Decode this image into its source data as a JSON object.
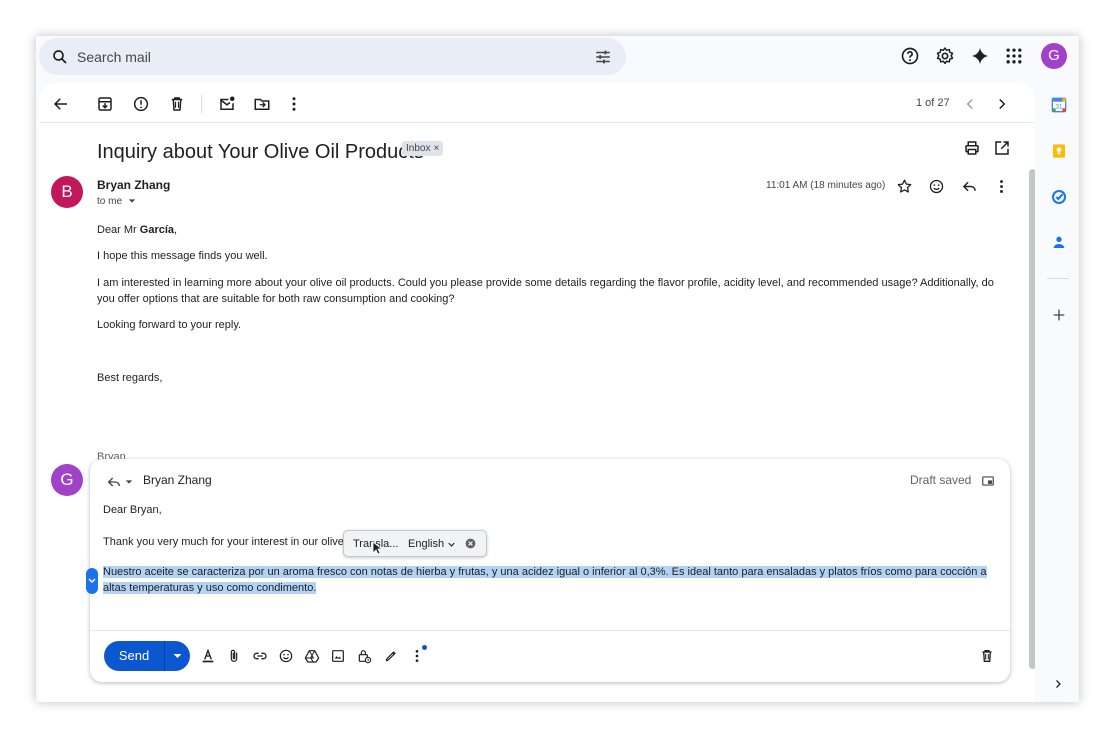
{
  "search": {
    "placeholder": "Search mail"
  },
  "header": {
    "icons": [
      "help-icon",
      "settings-icon",
      "gemini-icon",
      "apps-icon"
    ],
    "account_initial": "G"
  },
  "toolbar": {
    "icons": [
      "back-icon",
      "archive-icon",
      "report-spam-icon",
      "delete-icon",
      "mark-unread-icon",
      "move-to-icon",
      "more-icon"
    ],
    "pager": "1 of 27"
  },
  "email": {
    "subject": "Inquiry about Your Olive Oil Products",
    "label": "Inbox",
    "label_remove": "×",
    "sender": {
      "initial": "B",
      "name": "Bryan Zhang",
      "to": "to me"
    },
    "time": "11:01 AM (18 minutes ago)",
    "body": {
      "greeting_prefix": "Dear Mr ",
      "greeting_name": "García",
      "greeting_suffix": ",",
      "p1": "I hope this message finds you well.",
      "p2": "I am interested in learning more about your olive oil products. Could you please provide some details regarding the flavor profile, acidity level, and recommended usage? Additionally, do you offer options that are suitable for both raw consumption and cooking?",
      "p3": "Looking forward to your reply.",
      "closing": "Best regards,",
      "signature": "Bryan"
    }
  },
  "reply": {
    "avatar_initial": "G",
    "recipient": "Bryan Zhang",
    "draft_status": "Draft saved",
    "greeting": "Dear Bryan,",
    "line1": "Thank you very much for your interest in our olive o",
    "selected_text": "Nuestro aceite se caracteriza por un aroma fresco con notas de hierba y frutas, y una acidez igual o inferior al 0,3%. Es ideal tanto para ensaladas y platos fríos como para cocción a altas temperaturas y uso como condimento.",
    "send_label": "Send"
  },
  "translate_popup": {
    "label": "Transla...",
    "language": "English"
  },
  "side_panel": {
    "apps": [
      "calendar-icon",
      "keep-icon",
      "tasks-icon",
      "contacts-icon",
      "add-icon"
    ],
    "calendar_day": "31"
  },
  "colors": {
    "primary": "#0b57d0",
    "selection": "#b3d3f5",
    "avatar_g": "#a142c9",
    "avatar_b": "#c2185b"
  }
}
